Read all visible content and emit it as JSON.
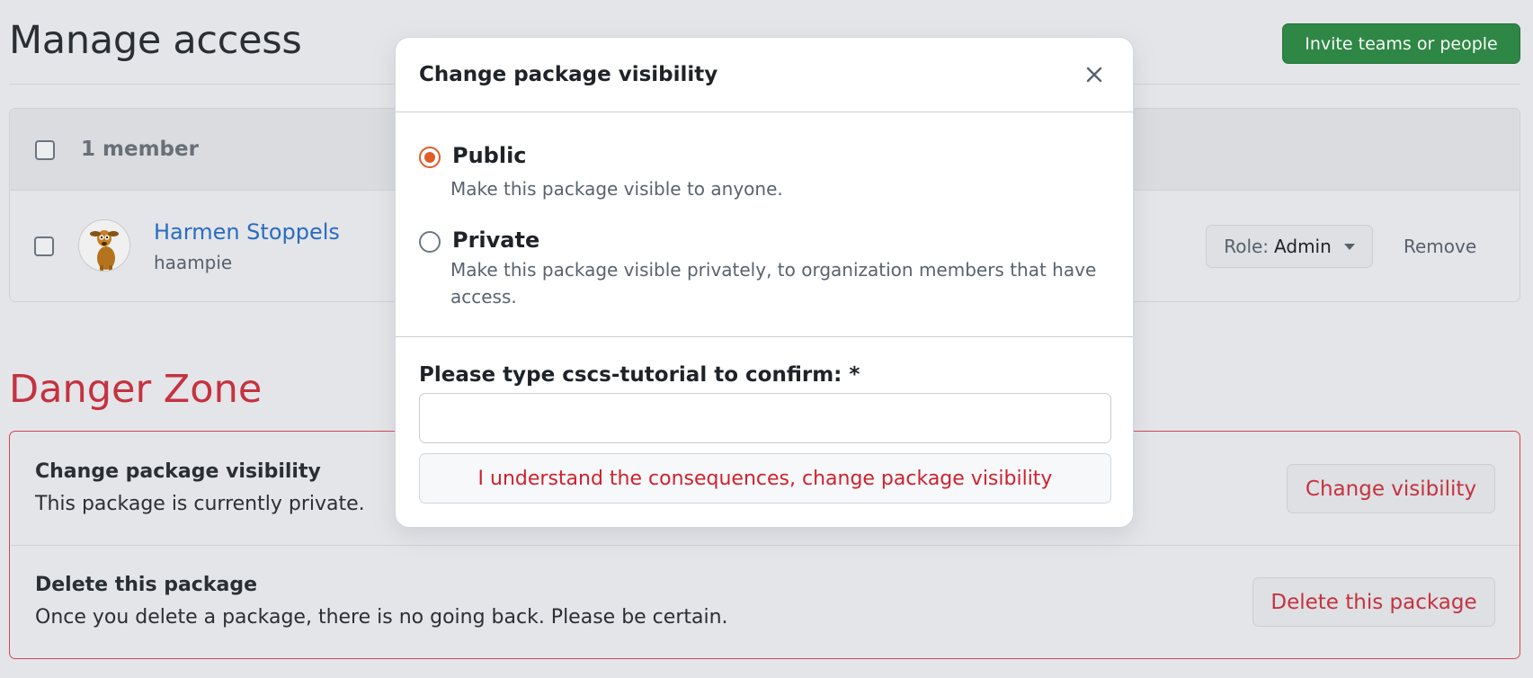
{
  "page": {
    "title": "Manage access",
    "invite_button": "Invite teams or people"
  },
  "members": {
    "count_label": "1 member",
    "rows": [
      {
        "name": "Harmen Stoppels",
        "login": "haampie",
        "role_prefix": "Role:",
        "role_value": "Admin",
        "remove_label": "Remove"
      }
    ]
  },
  "danger_zone": {
    "title": "Danger Zone",
    "items": [
      {
        "title": "Change package visibility",
        "description": "This package is currently private.",
        "button": "Change visibility"
      },
      {
        "title": "Delete this package",
        "description": "Once you delete a package, there is no going back. Please be certain.",
        "button": "Delete this package"
      }
    ]
  },
  "modal": {
    "title": "Change package visibility",
    "options": [
      {
        "label": "Public",
        "description": "Make this package visible to anyone.",
        "selected": true
      },
      {
        "label": "Private",
        "description": "Make this package visible privately, to organization members that have access.",
        "selected": false
      }
    ],
    "confirm_label": "Please type cscs-tutorial to confirm: *",
    "confirm_value": "",
    "confirm_button": "I understand the consequences, change package visibility"
  },
  "colors": {
    "accent_radio": "#e05b2a",
    "danger": "#c93442",
    "primary_green": "#2f8a47",
    "link": "#2a6fc5"
  }
}
